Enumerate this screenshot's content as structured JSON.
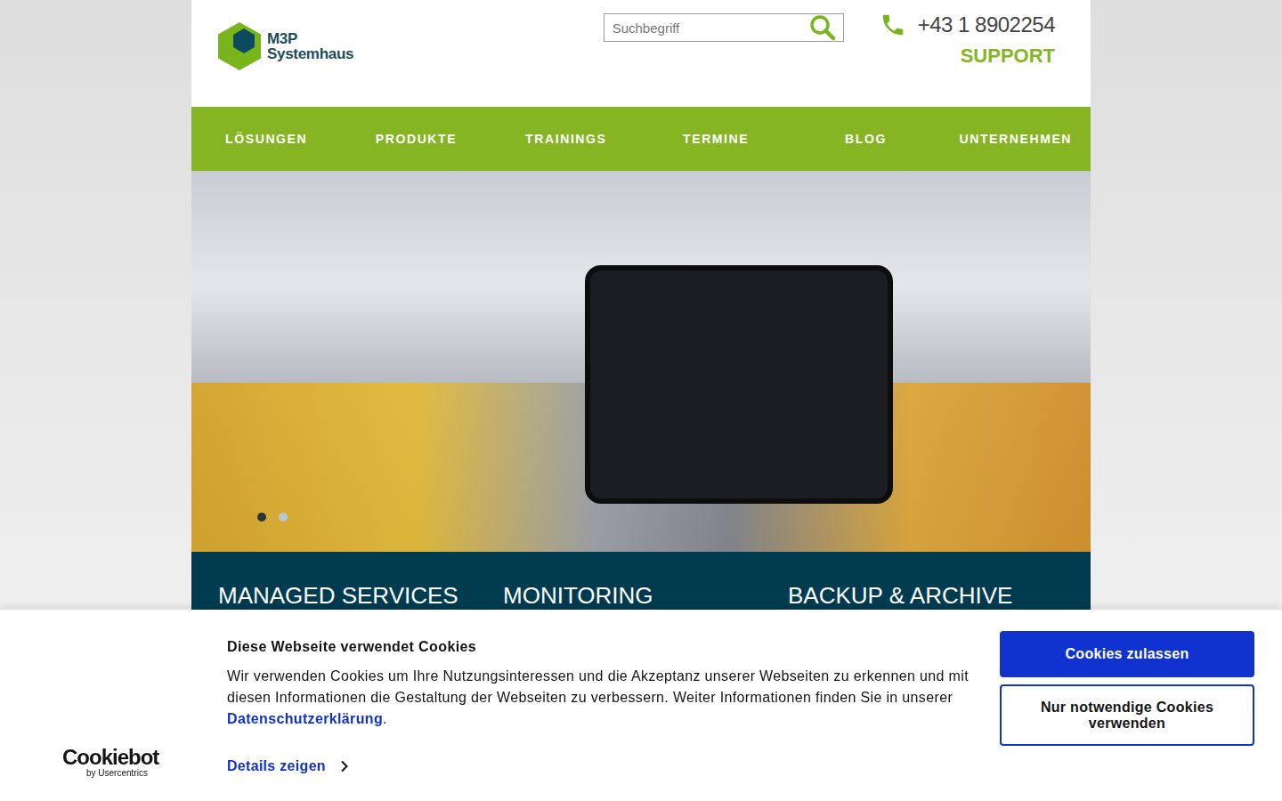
{
  "header": {
    "logo": {
      "line1": "M3P",
      "line2": "Systemhaus"
    },
    "search": {
      "placeholder": "Suchbegriff"
    },
    "phone": "+43 1 8902254",
    "support": "SUPPORT"
  },
  "nav": {
    "items": [
      "LÖSUNGEN",
      "PRODUKTE",
      "TRAININGS",
      "TERMINE",
      "BLOG",
      "UNTERNEHMEN"
    ]
  },
  "hero": {
    "dots": [
      {
        "selected": true
      },
      {
        "selected": false
      }
    ]
  },
  "services": [
    "MANAGED SERVICES",
    "MONITORING",
    "BACKUP & ARCHIVE"
  ],
  "cookie_banner": {
    "title": "Diese Webseite verwendet Cookies",
    "text": "Wir verwenden Cookies um Ihre Nutzungsinteressen und die Akzeptanz unserer Webseiten zu erkennen und mit diesen Informationen die Gestaltung der Webseiten zu verbessern. Weiter Informationen finden Sie in unserer ",
    "link": "Datenschutzerklärung",
    "text_after": ".",
    "details": "Details zeigen",
    "brand": {
      "name": "Cookiebot",
      "by": "by Usercentrics"
    },
    "buttons": [
      {
        "label": "Cookies zulassen",
        "kind": "primary"
      },
      {
        "label": "Nur notwendige Cookies verwenden",
        "kind": "secondary"
      }
    ]
  }
}
